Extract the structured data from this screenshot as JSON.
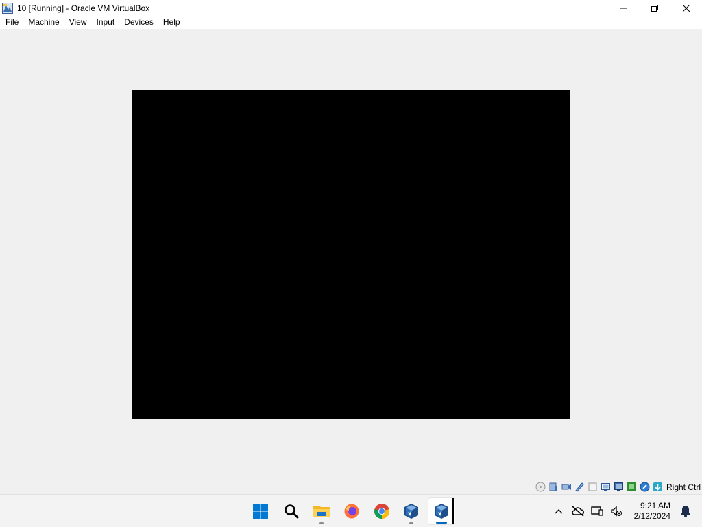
{
  "window": {
    "title": "10 [Running] - Oracle VM VirtualBox",
    "controls": [
      "minimize",
      "maximize",
      "close"
    ]
  },
  "menu": {
    "items": [
      {
        "label": "File"
      },
      {
        "label": "Machine"
      },
      {
        "label": "View"
      },
      {
        "label": "Input"
      },
      {
        "label": "Devices"
      },
      {
        "label": "Help"
      }
    ]
  },
  "vm": {
    "screen_color": "#000000"
  },
  "statusbar": {
    "icons": [
      "optical-drive-icon",
      "hard-disk-icon",
      "audio-icon",
      "network-icon",
      "usb-icon",
      "shared-folders-icon",
      "display-icon",
      "video-capture-icon",
      "cpu-icon",
      "mouse-integration-icon",
      "keyboard-capture-icon"
    ],
    "host_key": "Right Ctrl"
  },
  "taskbar": {
    "apps": [
      {
        "name": "start-button-icon"
      },
      {
        "name": "search-icon"
      },
      {
        "name": "file-explorer-icon"
      },
      {
        "name": "firefox-icon"
      },
      {
        "name": "chrome-icon"
      },
      {
        "name": "virtualbox-manager-icon"
      },
      {
        "name": "virtualbox-vm-icon"
      }
    ],
    "tray": {
      "time": "9:21 AM",
      "date": "2/12/2024"
    },
    "accent": "#0067c0"
  }
}
